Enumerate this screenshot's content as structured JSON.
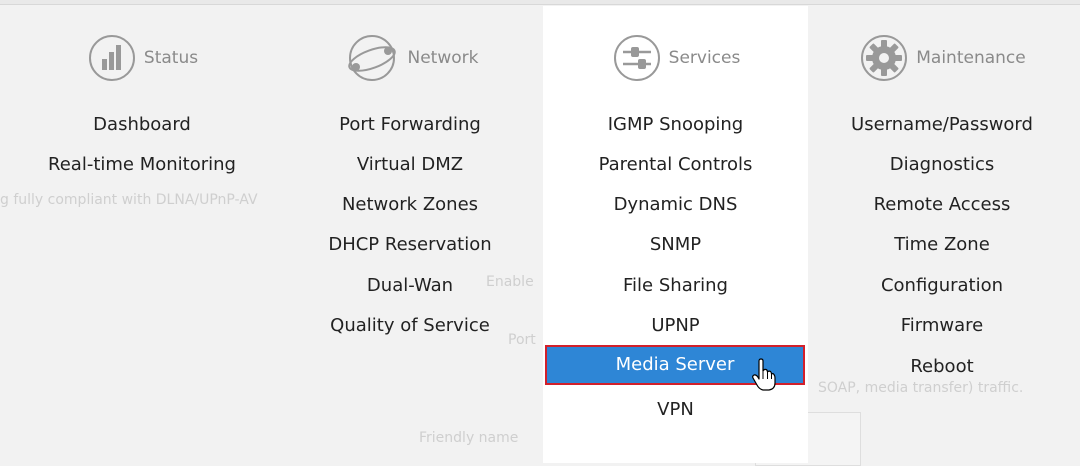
{
  "columns": [
    {
      "title": "Status",
      "icon": "status-bar-chart-icon",
      "items": [
        "Dashboard",
        "Real-time Monitoring"
      ]
    },
    {
      "title": "Network",
      "icon": "network-globe-icon",
      "items": [
        "Port Forwarding",
        "Virtual DMZ",
        "Network Zones",
        "DHCP Reservation",
        "Dual-Wan",
        "Quality of Service"
      ]
    },
    {
      "title": "Services",
      "icon": "services-sliders-icon",
      "items": [
        "IGMP Snooping",
        "Parental Controls",
        "Dynamic DNS",
        "SNMP",
        "File Sharing",
        "UPNP",
        "Media Server",
        "VPN"
      ],
      "selected_index": 6
    },
    {
      "title": "Maintenance",
      "icon": "maintenance-gear-icon",
      "items": [
        "Username/Password",
        "Diagnostics",
        "Remote Access",
        "Time Zone",
        "Configuration",
        "Firmware",
        "Reboot"
      ]
    }
  ],
  "background": {
    "text1": "g fully compliant with DLNA/UPnP-AV",
    "text2": "Enable",
    "text3": "Port",
    "text4": "SOAP, media transfer) traffic.",
    "text5": "Friendly name"
  },
  "colors": {
    "selected_bg": "#2e86d6",
    "selected_border": "#d2202b",
    "panel_bg": "#ffffff",
    "page_bg": "#f2f2f2"
  }
}
